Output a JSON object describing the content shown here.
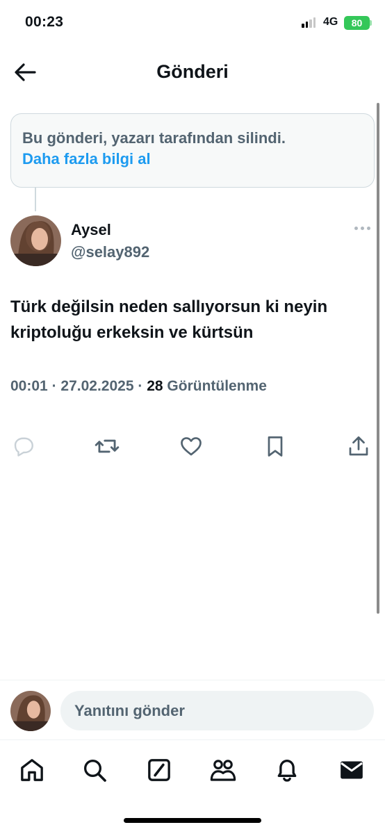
{
  "status_bar": {
    "time": "00:23",
    "network": "4G",
    "battery": "80"
  },
  "header": {
    "title": "Gönderi",
    "back_icon": "arrow-left-icon"
  },
  "notice": {
    "text": "Bu gönderi, yazarı tarafından silindi.",
    "link": "Daha fazla bilgi al"
  },
  "author": {
    "name": "Aysel",
    "handle": "@selay892"
  },
  "tweet": {
    "text": "Türk değilsin neden sallıyorsun ki neyin kriptoluğu erkeksin ve kürtsün",
    "time": "00:01",
    "date": "27.02.2025",
    "views": "28",
    "views_label": "Görüntülenme"
  },
  "actions": [
    "reply-icon",
    "retweet-icon",
    "like-icon",
    "bookmark-icon",
    "share-icon"
  ],
  "reply": {
    "placeholder": "Yanıtını gönder"
  },
  "nav": [
    "home-icon",
    "search-icon",
    "grok-icon",
    "communities-icon",
    "notifications-icon",
    "messages-icon"
  ],
  "colors": {
    "accent": "#1d9bf0",
    "secondary_text": "#536471",
    "border": "#cfd9de"
  }
}
